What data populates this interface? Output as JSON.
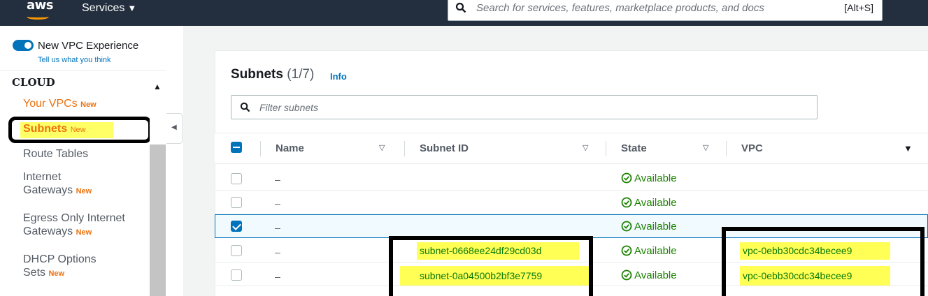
{
  "topbar": {
    "logo": "aws",
    "services_label": "Services",
    "services_caret": "▼",
    "search_placeholder": "Search for services, features, marketplace products, and docs",
    "search_shortcut": "[Alt+S]"
  },
  "sidebar": {
    "toggle_label": "New VPC Experience",
    "feedback_link": "Tell us what you think",
    "section": "CLOUD",
    "items": [
      {
        "label": "Your VPCs",
        "badge": "New"
      },
      {
        "label": "Subnets",
        "badge": "New"
      },
      {
        "label": "Route Tables",
        "badge": ""
      },
      {
        "label_line1": "Internet",
        "label_line2": "Gateways",
        "badge": "New"
      },
      {
        "label_line1": "Egress Only Internet",
        "label_line2": "Gateways",
        "badge": "New"
      },
      {
        "label_line1": "DHCP Options",
        "label_line2": "Sets",
        "badge": "New"
      }
    ],
    "collapse_icon": "◀",
    "scroll_up_icon": "▲"
  },
  "main": {
    "title": "Subnets",
    "count": "(1/7)",
    "info": "Info",
    "filter_placeholder": "Filter subnets",
    "columns": [
      "Name",
      "Subnet ID",
      "State",
      "VPC"
    ],
    "sort_icon": "▽",
    "vpc_sort_icon": "▼",
    "rows": [
      {
        "name": "–",
        "subnet_id": "",
        "state": "Available",
        "vpc": "",
        "checked": false
      },
      {
        "name": "–",
        "subnet_id": "",
        "state": "Available",
        "vpc": "",
        "checked": false
      },
      {
        "name": "–",
        "subnet_id": "",
        "state": "Available",
        "vpc": "",
        "checked": true
      },
      {
        "name": "–",
        "subnet_id": "subnet-0668ee24df29cd03d",
        "state": "Available",
        "vpc": "vpc-0ebb30cdc34becee9",
        "checked": false
      },
      {
        "name": "–",
        "subnet_id": "subnet-0a04500b2bf3e7759",
        "state": "Available",
        "vpc": "vpc-0ebb30cdc34becee9",
        "checked": false
      }
    ]
  },
  "colors": {
    "nav_bg": "#232f3e",
    "accent_orange": "#ec7211",
    "link_blue": "#0073bb",
    "available_green": "#1d8102",
    "highlight_yellow": "#ffff55"
  }
}
